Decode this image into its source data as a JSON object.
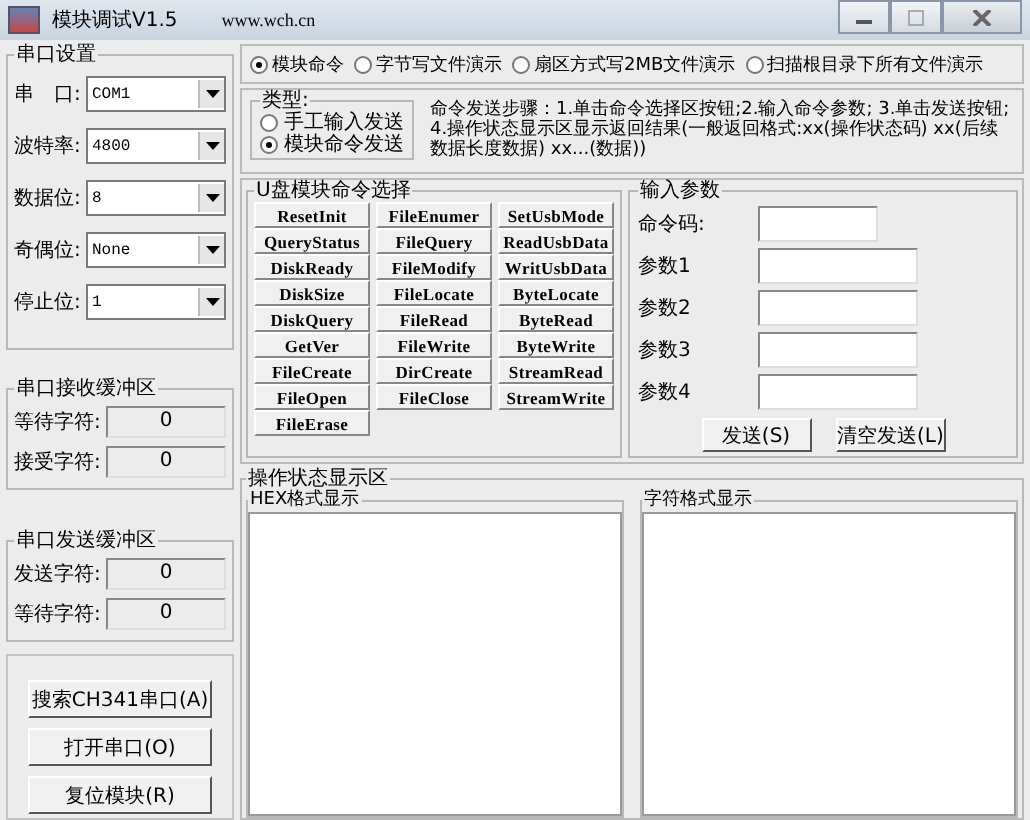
{
  "window": {
    "title": "模块调试V1.5",
    "url": "www.wch.cn"
  },
  "serial_settings": {
    "title": "串口设置",
    "fields": [
      {
        "label": "串　口:",
        "value": "COM1"
      },
      {
        "label": "波特率:",
        "value": "4800"
      },
      {
        "label": "数据位:",
        "value": "8"
      },
      {
        "label": "奇偶位:",
        "value": "None"
      },
      {
        "label": "停止位:",
        "value": "1"
      }
    ]
  },
  "receive_buffer": {
    "title": "串口接收缓冲区",
    "fields": [
      {
        "label": "等待字符:",
        "value": "0"
      },
      {
        "label": "接受字符:",
        "value": "0"
      }
    ]
  },
  "send_buffer": {
    "title": "串口发送缓冲区",
    "fields": [
      {
        "label": "发送字符:",
        "value": "0"
      },
      {
        "label": "等待字符:",
        "value": "0"
      }
    ]
  },
  "actions": [
    "搜索CH341串口(A)",
    "打开串口(O)",
    "复位模块(R)"
  ],
  "modes": [
    {
      "label": "模块命令",
      "selected": true
    },
    {
      "label": "字节写文件演示",
      "selected": false
    },
    {
      "label": "扇区方式写2MB文件演示",
      "selected": false
    },
    {
      "label": "扫描根目录下所有文件演示",
      "selected": false
    }
  ],
  "send_type": {
    "title": "类型:",
    "options": [
      {
        "label": "手工输入发送",
        "selected": false
      },
      {
        "label": "模块命令发送",
        "selected": true
      }
    ]
  },
  "instructions": "命令发送步骤：1.单击命令选择区按钮;2.输入命令参数; 3.单击发送按钮; 4.操作状态显示区显示返回结果(一般返回格式:xx(操作状态码) xx(后续数据长度数据) xx...(数据))",
  "commands": {
    "title": "U盘模块命令选择",
    "columns": [
      [
        "ResetInit",
        "QueryStatus",
        "DiskReady",
        "DiskSize",
        "DiskQuery",
        "GetVer",
        "FileCreate",
        "FileOpen",
        "FileErase"
      ],
      [
        "FileEnumer",
        "FileQuery",
        "FileModify",
        "FileLocate",
        "FileRead",
        "FileWrite",
        "DirCreate",
        "FileClose"
      ],
      [
        "SetUsbMode",
        "ReadUsbData",
        "WritUsbData",
        "ByteLocate",
        "ByteRead",
        "ByteWrite",
        "StreamRead",
        "StreamWrite"
      ]
    ]
  },
  "parameters": {
    "title": "输入参数",
    "fields": [
      {
        "label": "命令码:",
        "kind": "short"
      },
      {
        "label": "参数1",
        "kind": "long"
      },
      {
        "label": "参数2",
        "kind": "long"
      },
      {
        "label": "参数3",
        "kind": "long"
      },
      {
        "label": "参数4",
        "kind": "long"
      }
    ],
    "buttons": [
      "发送(S)",
      "清空发送(L)"
    ]
  },
  "status": {
    "title": "操作状态显示区",
    "panes": [
      "HEX格式显示",
      "字符格式显示"
    ]
  }
}
